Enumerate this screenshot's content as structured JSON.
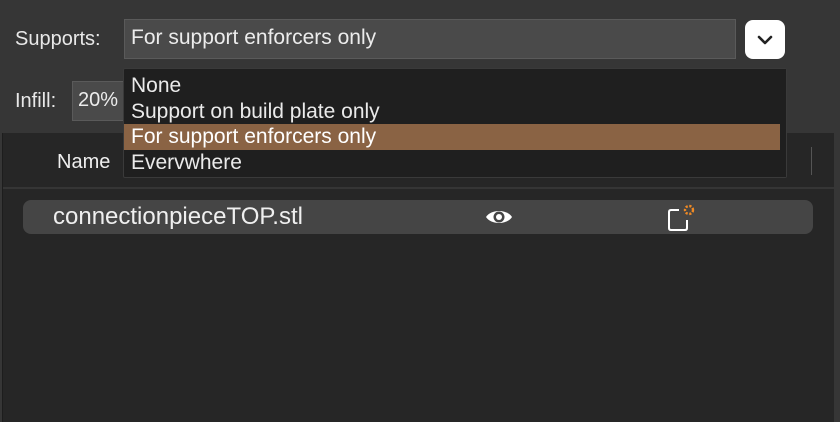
{
  "supports": {
    "label": "Supports:",
    "value": "For support enforcers only",
    "options": [
      {
        "label": "None",
        "selected": false
      },
      {
        "label": "Support on build plate only",
        "selected": false
      },
      {
        "label": "For support enforcers only",
        "selected": true
      },
      {
        "label": "Evervwhere",
        "selected": false
      }
    ]
  },
  "infill": {
    "label": "Infill:",
    "value": "20%"
  },
  "object_list": {
    "name_header": "Name",
    "rows": [
      {
        "name": "connectionpieceTOP.stl",
        "visibility_icon": "eye-icon",
        "settings_icon": "object-settings-icon"
      }
    ]
  },
  "colors": {
    "selection": "#8a6344",
    "accent_orange": "#f08a24"
  }
}
